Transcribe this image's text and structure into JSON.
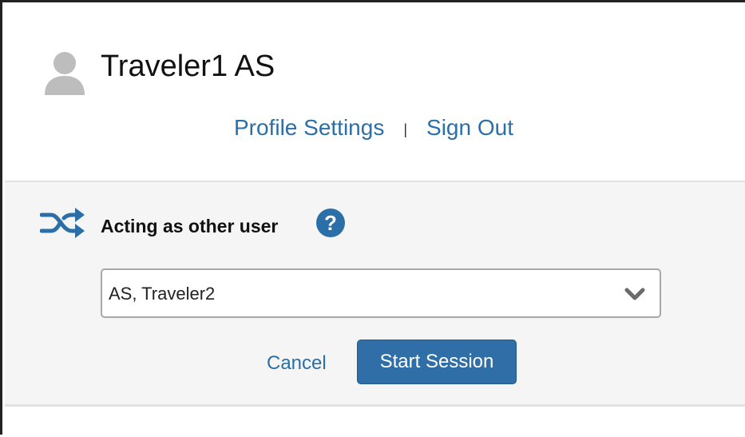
{
  "user": {
    "name": "Traveler1 AS",
    "avatar_icon": "user-silhouette-icon"
  },
  "links": {
    "profile_settings": "Profile Settings",
    "separator": "|",
    "sign_out": "Sign Out"
  },
  "acting_as": {
    "icon": "shuffle-icon",
    "title": "Acting as other user",
    "help_icon": "question-circle-icon",
    "selected_user": "AS, Traveler2",
    "cancel_label": "Cancel",
    "start_label": "Start Session"
  },
  "colors": {
    "accent": "#2f6ea6",
    "link": "#2a6fa8",
    "panel_bg": "#f5f5f5"
  }
}
